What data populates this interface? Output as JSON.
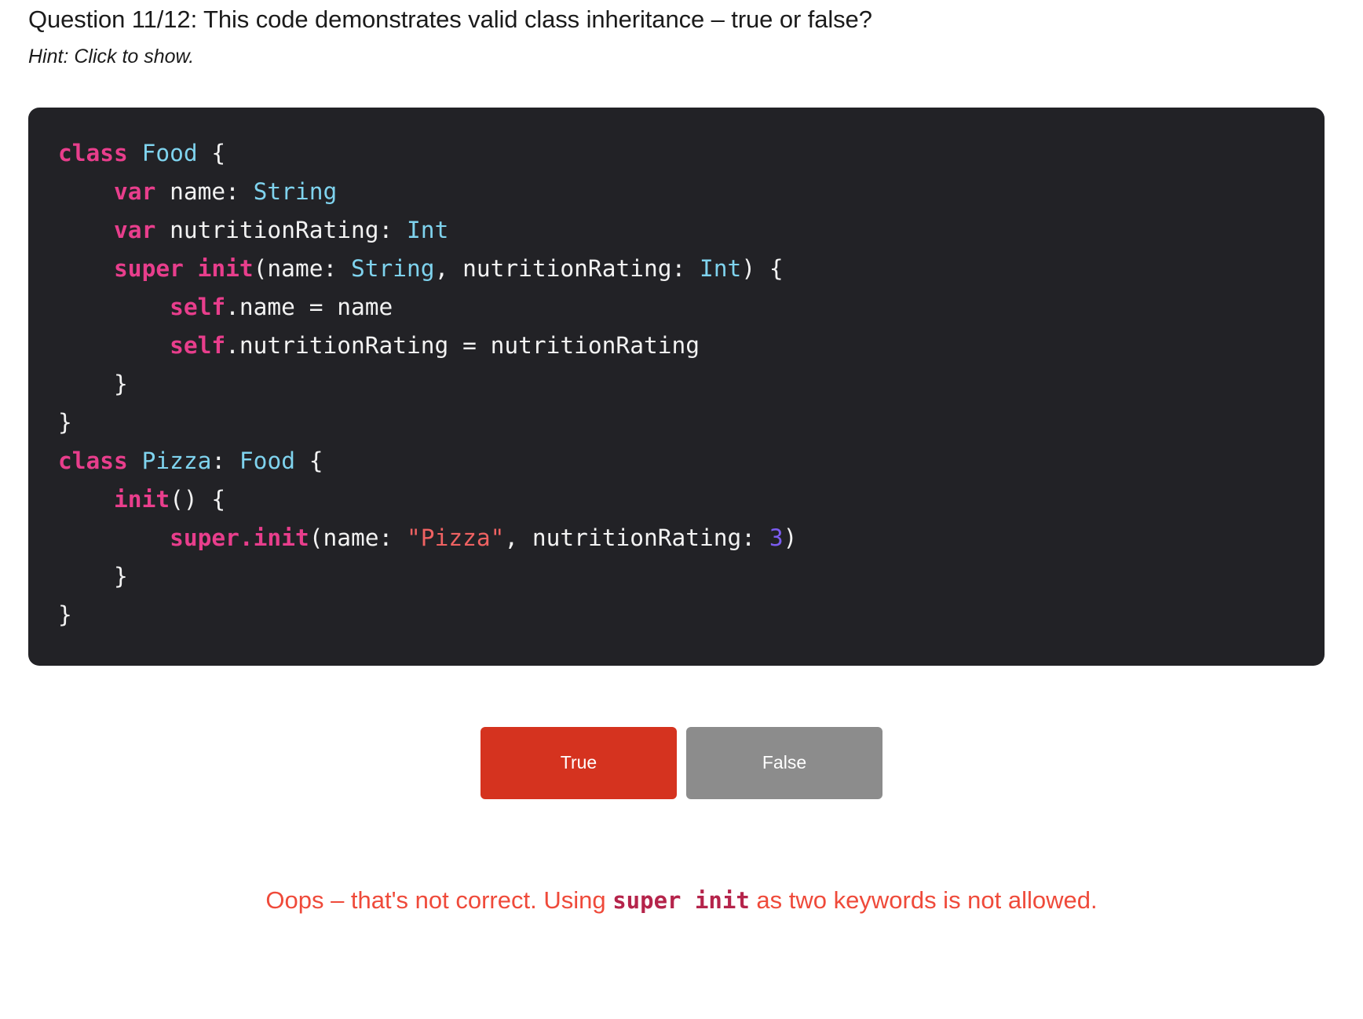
{
  "question": {
    "title": "Question 11/12: This code demonstrates valid class inheritance – true or false?",
    "hint": "Hint: Click to show."
  },
  "code_block": {
    "language": "swift",
    "background_color": "#222226",
    "token_colors": {
      "keyword": "#e83e8c",
      "type": "#7fd3ee",
      "string": "#ef6262",
      "number": "#7b5cf0",
      "plain": "#f2f2f2"
    },
    "lines": [
      [
        {
          "t": "class",
          "c": "kw"
        },
        {
          "t": " ",
          "c": "plain"
        },
        {
          "t": "Food",
          "c": "type"
        },
        {
          "t": " {",
          "c": "plain"
        }
      ],
      [
        {
          "t": "    ",
          "c": "plain"
        },
        {
          "t": "var",
          "c": "kw"
        },
        {
          "t": " name: ",
          "c": "plain"
        },
        {
          "t": "String",
          "c": "type"
        }
      ],
      [
        {
          "t": "    ",
          "c": "plain"
        },
        {
          "t": "var",
          "c": "kw"
        },
        {
          "t": " nutritionRating: ",
          "c": "plain"
        },
        {
          "t": "Int",
          "c": "type"
        }
      ],
      [
        {
          "t": "    ",
          "c": "plain"
        },
        {
          "t": "super init",
          "c": "kw"
        },
        {
          "t": "(name: ",
          "c": "plain"
        },
        {
          "t": "String",
          "c": "type"
        },
        {
          "t": ", nutritionRating: ",
          "c": "plain"
        },
        {
          "t": "Int",
          "c": "type"
        },
        {
          "t": ") {",
          "c": "plain"
        }
      ],
      [
        {
          "t": "        ",
          "c": "plain"
        },
        {
          "t": "self",
          "c": "kw"
        },
        {
          "t": ".name = name",
          "c": "plain"
        }
      ],
      [
        {
          "t": "        ",
          "c": "plain"
        },
        {
          "t": "self",
          "c": "kw"
        },
        {
          "t": ".nutritionRating = nutritionRating",
          "c": "plain"
        }
      ],
      [
        {
          "t": "    }",
          "c": "plain"
        }
      ],
      [
        {
          "t": "}",
          "c": "plain"
        }
      ],
      [
        {
          "t": "class",
          "c": "kw"
        },
        {
          "t": " ",
          "c": "plain"
        },
        {
          "t": "Pizza",
          "c": "type"
        },
        {
          "t": ": ",
          "c": "plain"
        },
        {
          "t": "Food",
          "c": "type"
        },
        {
          "t": " {",
          "c": "plain"
        }
      ],
      [
        {
          "t": "    ",
          "c": "plain"
        },
        {
          "t": "init",
          "c": "kw"
        },
        {
          "t": "() {",
          "c": "plain"
        }
      ],
      [
        {
          "t": "        ",
          "c": "plain"
        },
        {
          "t": "super",
          "c": "kw"
        },
        {
          "t": ".",
          "c": "kw"
        },
        {
          "t": "init",
          "c": "kw"
        },
        {
          "t": "(name: ",
          "c": "plain"
        },
        {
          "t": "\"Pizza\"",
          "c": "str"
        },
        {
          "t": ", nutritionRating: ",
          "c": "plain"
        },
        {
          "t": "3",
          "c": "num"
        },
        {
          "t": ")",
          "c": "plain"
        }
      ],
      [
        {
          "t": "    }",
          "c": "plain"
        }
      ],
      [
        {
          "t": "}",
          "c": "plain"
        }
      ]
    ]
  },
  "answers": {
    "true_label": "True",
    "false_label": "False",
    "selected": "True",
    "true_color": "#d5331f",
    "false_color": "#8c8c8c"
  },
  "feedback": {
    "color": "#ef4a3a",
    "prefix": "Oops – that's not correct. Using ",
    "code": "super init",
    "suffix": " as two keywords is not allowed."
  }
}
